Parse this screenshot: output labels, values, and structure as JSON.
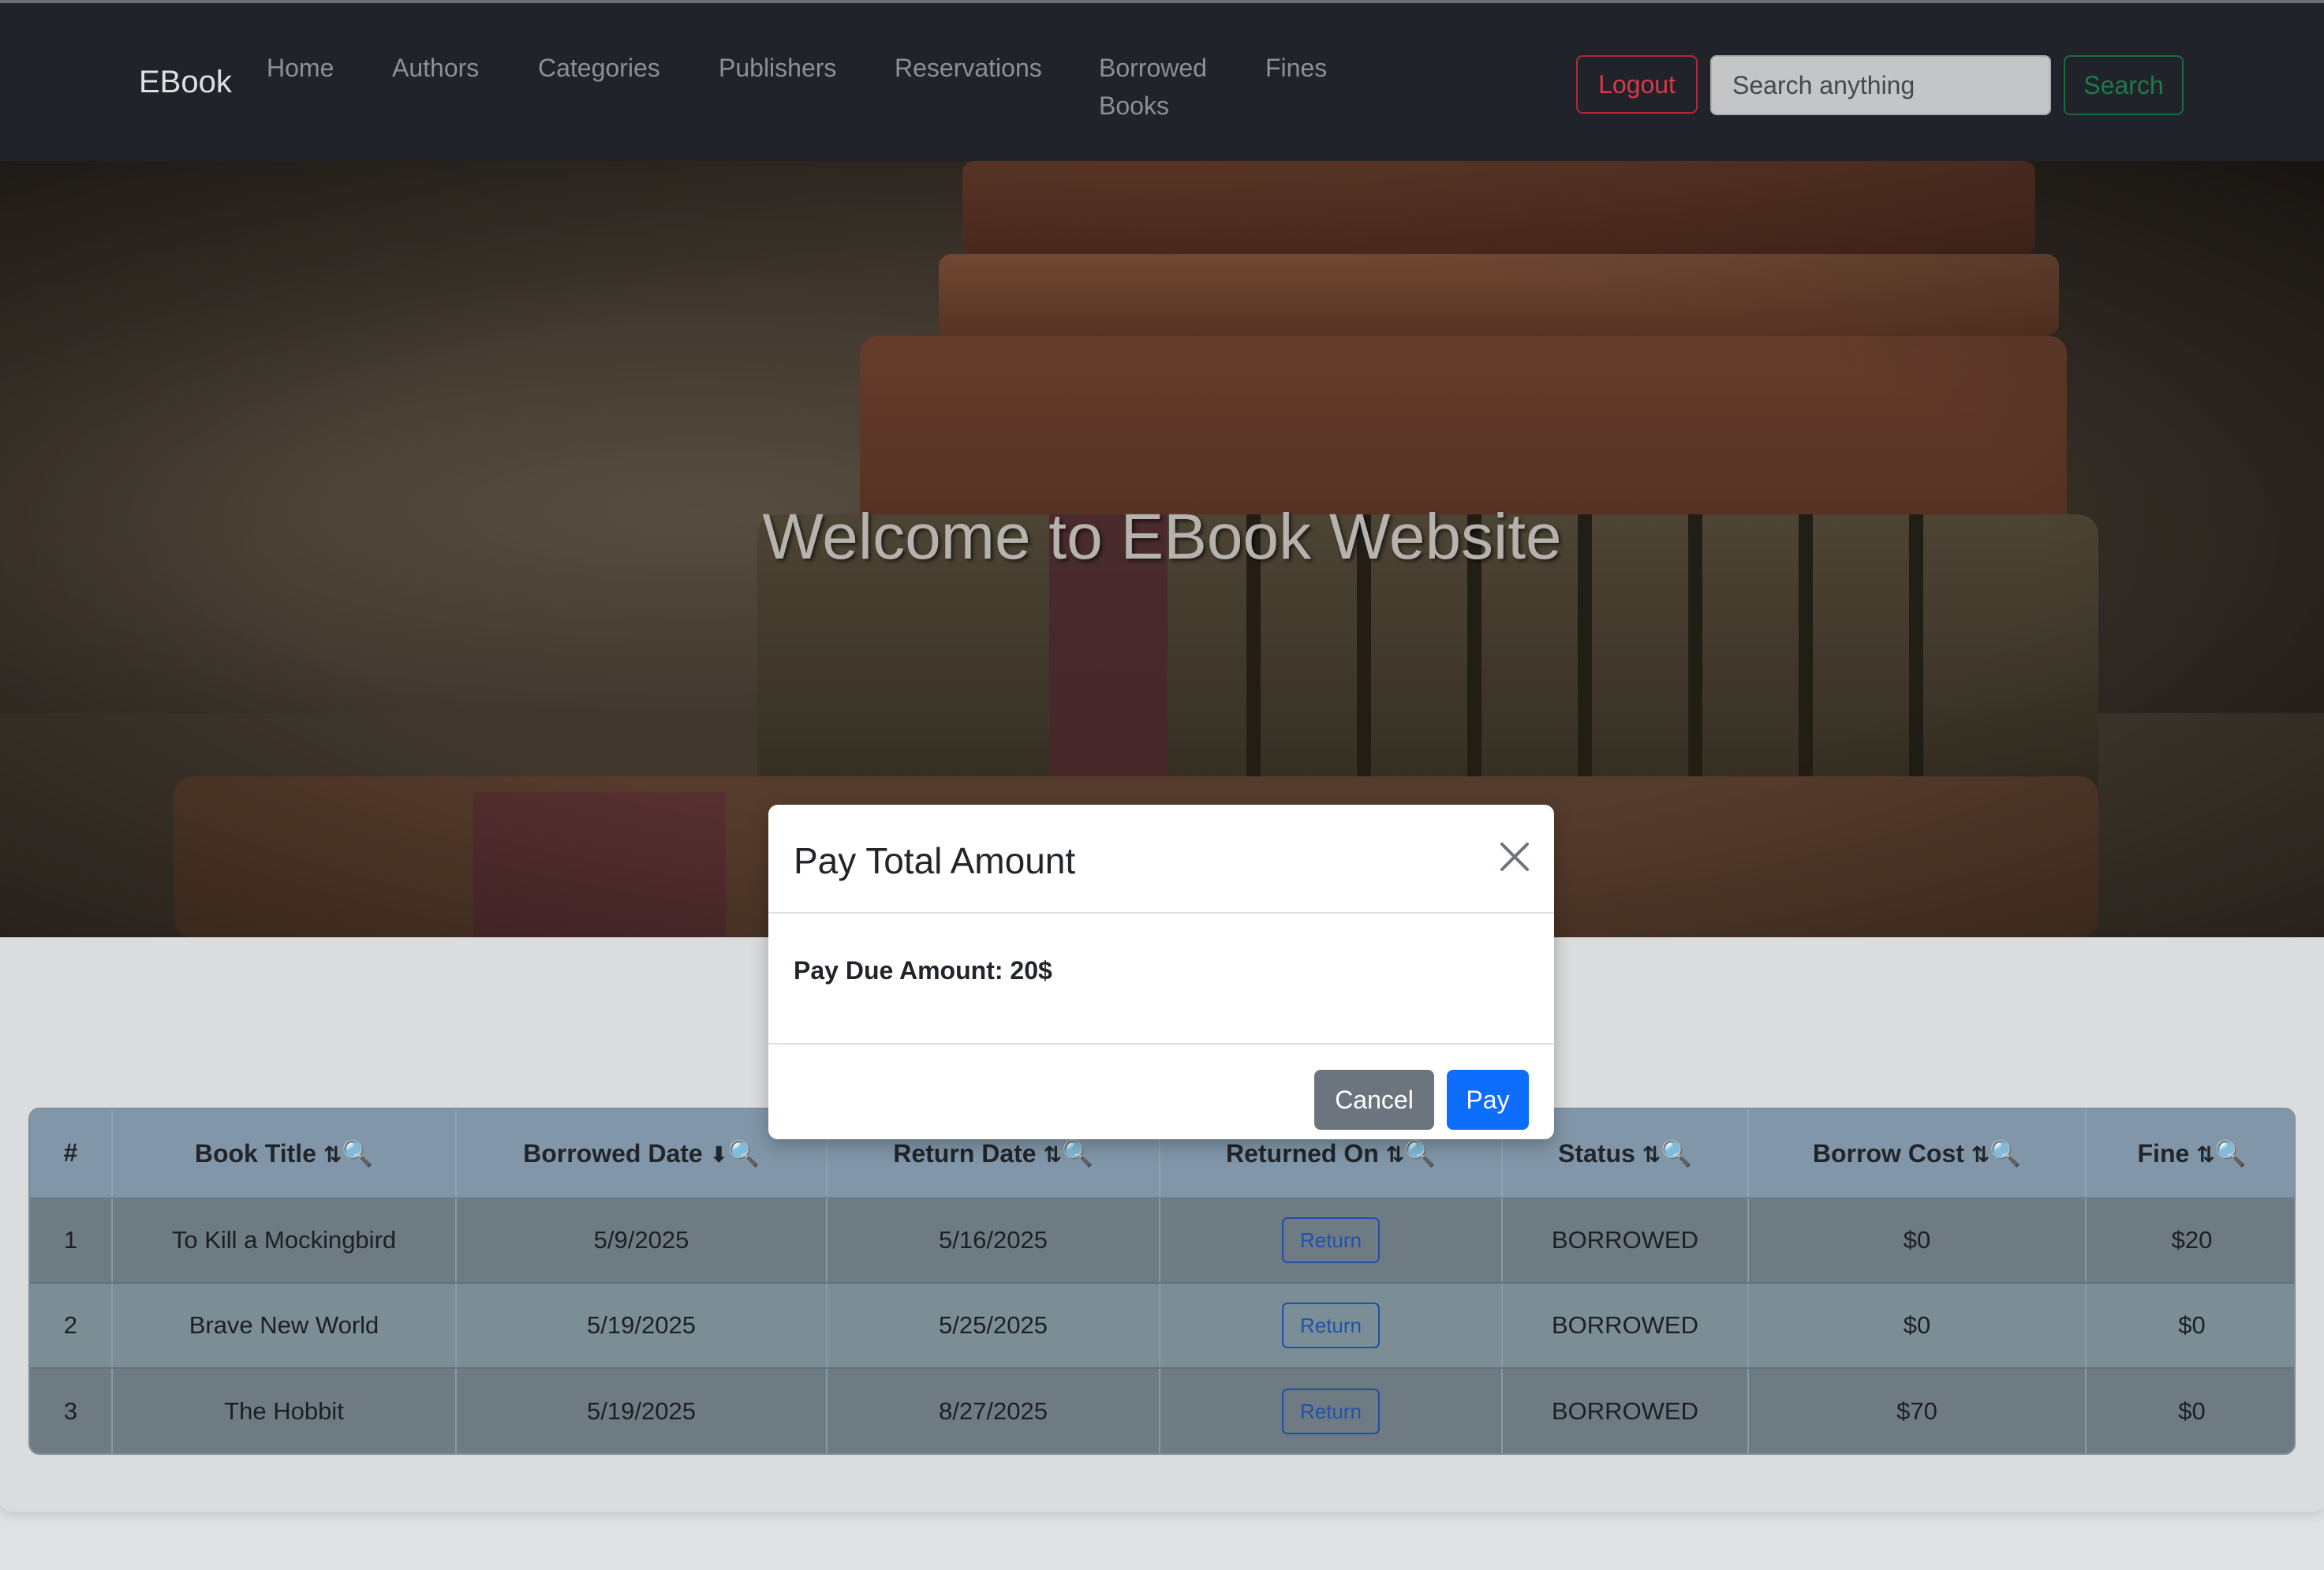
{
  "navbar": {
    "brand": "EBook",
    "links": [
      "Home",
      "Authors",
      "Categories",
      "Publishers",
      "Reservations",
      "Borrowed Books",
      "Fines"
    ],
    "logout_label": "Logout",
    "search_placeholder": "Search anything",
    "search_label": "Search"
  },
  "hero": {
    "title": "Welcome to EBook Website"
  },
  "table": {
    "headers": [
      "#",
      "Book Title",
      "Borrowed Date",
      "Return Date",
      "Returned On",
      "Status",
      "Borrow Cost",
      "Fine"
    ],
    "rows": [
      {
        "num": "1",
        "title": "To Kill a Mockingbird",
        "borrowed": "5/9/2025",
        "return_date": "5/16/2025",
        "returned_on": "Return",
        "status": "BORROWED",
        "cost": "$0",
        "fine": "$20"
      },
      {
        "num": "2",
        "title": "Brave New World",
        "borrowed": "5/19/2025",
        "return_date": "5/25/2025",
        "returned_on": "Return",
        "status": "BORROWED",
        "cost": "$0",
        "fine": "$0"
      },
      {
        "num": "3",
        "title": "The Hobbit",
        "borrowed": "5/19/2025",
        "return_date": "8/27/2025",
        "returned_on": "Return",
        "status": "BORROWED",
        "cost": "$70",
        "fine": "$0"
      }
    ]
  },
  "modal": {
    "title": "Pay Total Amount",
    "body": "Pay Due Amount: 20$",
    "cancel_label": "Cancel",
    "pay_label": "Pay"
  },
  "colors": {
    "navbar_bg": "#202329",
    "logout": "#d9394a",
    "search_btn": "#1d7a4a",
    "pay_btn": "#0d6efd",
    "cancel_btn": "#6c757d",
    "table_header": "#8197a9"
  }
}
